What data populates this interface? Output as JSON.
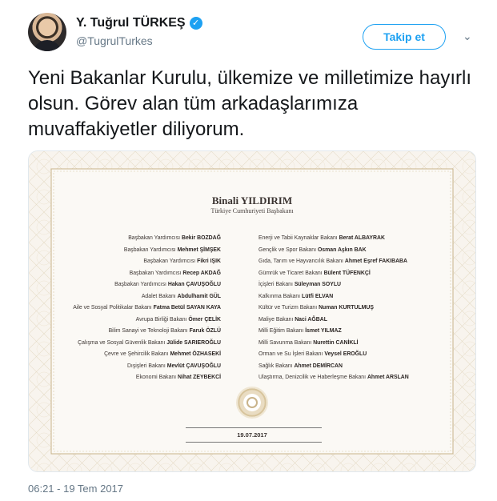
{
  "profile": {
    "name": "Y. Tuğrul TÜRKEŞ",
    "handle": "@TugrulTurkes",
    "verified_glyph": "✓",
    "follow_label": "Takip et",
    "menu_glyph": "⌄"
  },
  "tweet": {
    "text": "Yeni Bakanlar Kurulu, ülkemize ve milletimize hayırlı olsun. Görev alan tüm arkadaşlarımıza muvaffakiyetler diliyorum.",
    "timestamp": "06:21 - 19 Tem 2017"
  },
  "certificate": {
    "title": "Binali YILDIRIM",
    "subtitle": "Türkiye Cumhuriyeti Başbakanı",
    "date": "19.07.2017",
    "left": [
      {
        "role": "Başbakan Yardımcısı",
        "person": "Bekir BOZDAĞ"
      },
      {
        "role": "Başbakan Yardımcısı",
        "person": "Mehmet ŞİMŞEK"
      },
      {
        "role": "Başbakan Yardımcısı",
        "person": "Fikri IŞIK"
      },
      {
        "role": "Başbakan Yardımcısı",
        "person": "Recep AKDAĞ"
      },
      {
        "role": "Başbakan Yardımcısı",
        "person": "Hakan ÇAVUŞOĞLU"
      },
      {
        "role": "Adalet Bakanı",
        "person": "Abdulhamit GÜL"
      },
      {
        "role": "Aile ve Sosyal Politikalar Bakanı",
        "person": "Fatma Betül SAYAN KAYA"
      },
      {
        "role": "Avrupa Birliği Bakanı",
        "person": "Ömer ÇELİK"
      },
      {
        "role": "Bilim Sanayi ve Teknoloji Bakanı",
        "person": "Faruk ÖZLÜ"
      },
      {
        "role": "Çalışma ve Sosyal Güvenlik Bakanı",
        "person": "Jülide SARIEROĞLU"
      },
      {
        "role": "Çevre ve Şehircilik Bakanı",
        "person": "Mehmet ÖZHASEKİ"
      },
      {
        "role": "Dışişleri Bakanı",
        "person": "Mevlüt ÇAVUŞOĞLU"
      },
      {
        "role": "Ekonomi Bakanı",
        "person": "Nihat ZEYBEKCİ"
      }
    ],
    "right": [
      {
        "role": "Enerji ve Tabii Kaynaklar Bakanı",
        "person": "Berat ALBAYRAK"
      },
      {
        "role": "Gençlik ve Spor Bakanı",
        "person": "Osman Aşkın BAK"
      },
      {
        "role": "Gıda, Tarım ve Hayvancılık Bakanı",
        "person": "Ahmet Eşref FAKIBABA"
      },
      {
        "role": "Gümrük ve Ticaret Bakanı",
        "person": "Bülent TÜFENKÇİ"
      },
      {
        "role": "İçişleri Bakanı",
        "person": "Süleyman SOYLU"
      },
      {
        "role": "Kalkınma Bakanı",
        "person": "Lütfi ELVAN"
      },
      {
        "role": "Kültür ve Turizm Bakanı",
        "person": "Numan KURTULMUŞ"
      },
      {
        "role": "Maliye Bakanı",
        "person": "Naci AĞBAL"
      },
      {
        "role": "Milli Eğitim Bakanı",
        "person": "İsmet YILMAZ"
      },
      {
        "role": "Milli Savunma Bakanı",
        "person": "Nurettin CANİKLİ"
      },
      {
        "role": "Orman ve Su İşleri Bakanı",
        "person": "Veysel EROĞLU"
      },
      {
        "role": "Sağlık Bakanı",
        "person": "Ahmet DEMİRCAN"
      },
      {
        "role": "Ulaştırma, Denizcilik ve Haberleşme Bakanı",
        "person": "Ahmet ARSLAN"
      }
    ]
  }
}
